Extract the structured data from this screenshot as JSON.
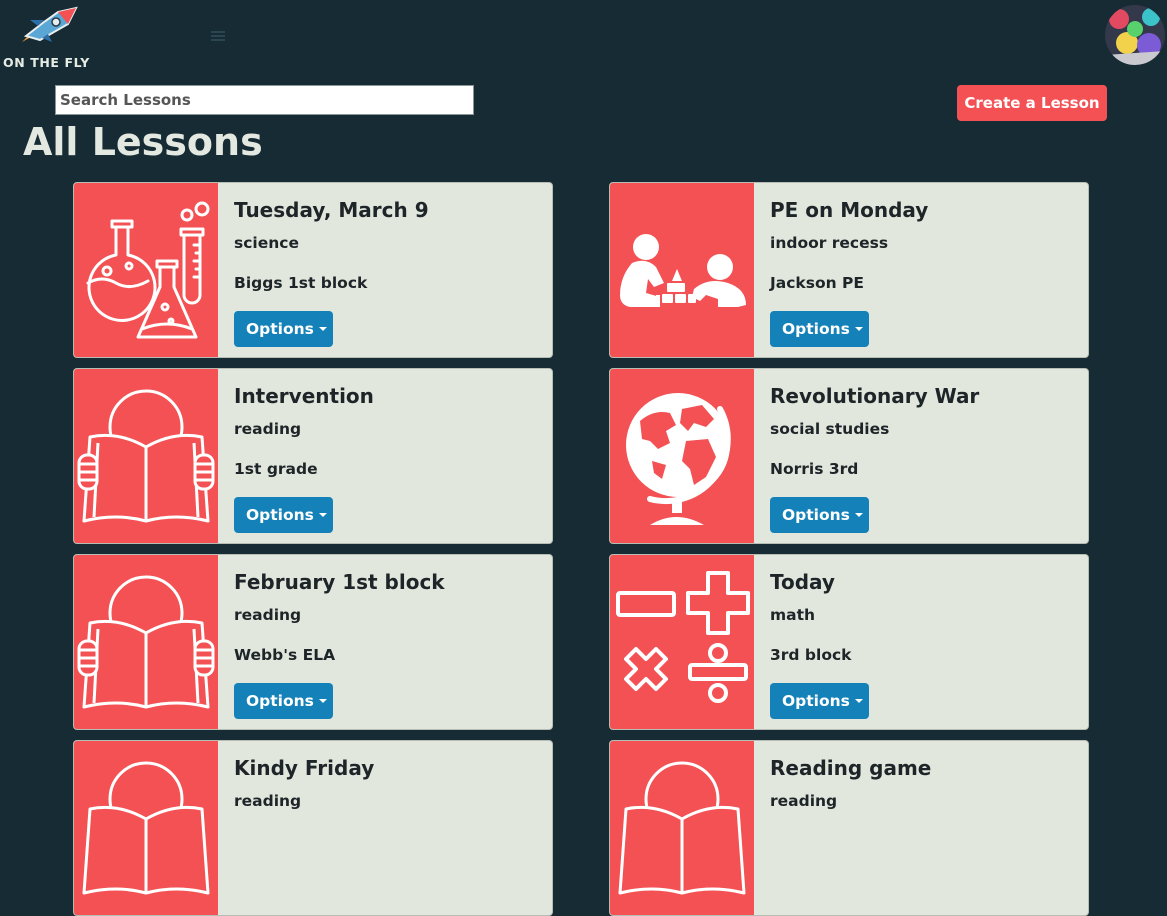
{
  "brand": {
    "name": "ON THE FLY",
    "logo_icon": "rocket-icon",
    "accent": "#f35154"
  },
  "header": {
    "menu_icon": "hamburger-icon",
    "avatar_icon": "user-avatar"
  },
  "search": {
    "placeholder": "Search Lessons",
    "value": ""
  },
  "create_button": {
    "label": "Create a Lesson"
  },
  "page": {
    "title": "All Lessons"
  },
  "options_label": "Options",
  "lessons": [
    {
      "title": "Tuesday, March 9",
      "subject": "science",
      "class_name": "Biggs 1st block",
      "icon": "science-flasks-icon"
    },
    {
      "title": "PE on Monday",
      "subject": "indoor recess",
      "class_name": "Jackson PE",
      "icon": "kids-playing-blocks-icon"
    },
    {
      "title": "Intervention",
      "subject": "reading",
      "class_name": "1st grade",
      "icon": "reading-book-icon"
    },
    {
      "title": "Revolutionary War",
      "subject": "social studies",
      "class_name": "Norris 3rd",
      "icon": "globe-icon"
    },
    {
      "title": "February 1st block",
      "subject": "reading",
      "class_name": "Webb's ELA",
      "icon": "reading-book-icon"
    },
    {
      "title": "Today",
      "subject": "math",
      "class_name": "3rd block",
      "icon": "math-symbols-icon"
    },
    {
      "title": "Kindy Friday",
      "subject": "reading",
      "class_name": "",
      "icon": "reading-book-icon"
    },
    {
      "title": "Reading game",
      "subject": "reading",
      "class_name": "",
      "icon": "reading-book-icon"
    }
  ]
}
